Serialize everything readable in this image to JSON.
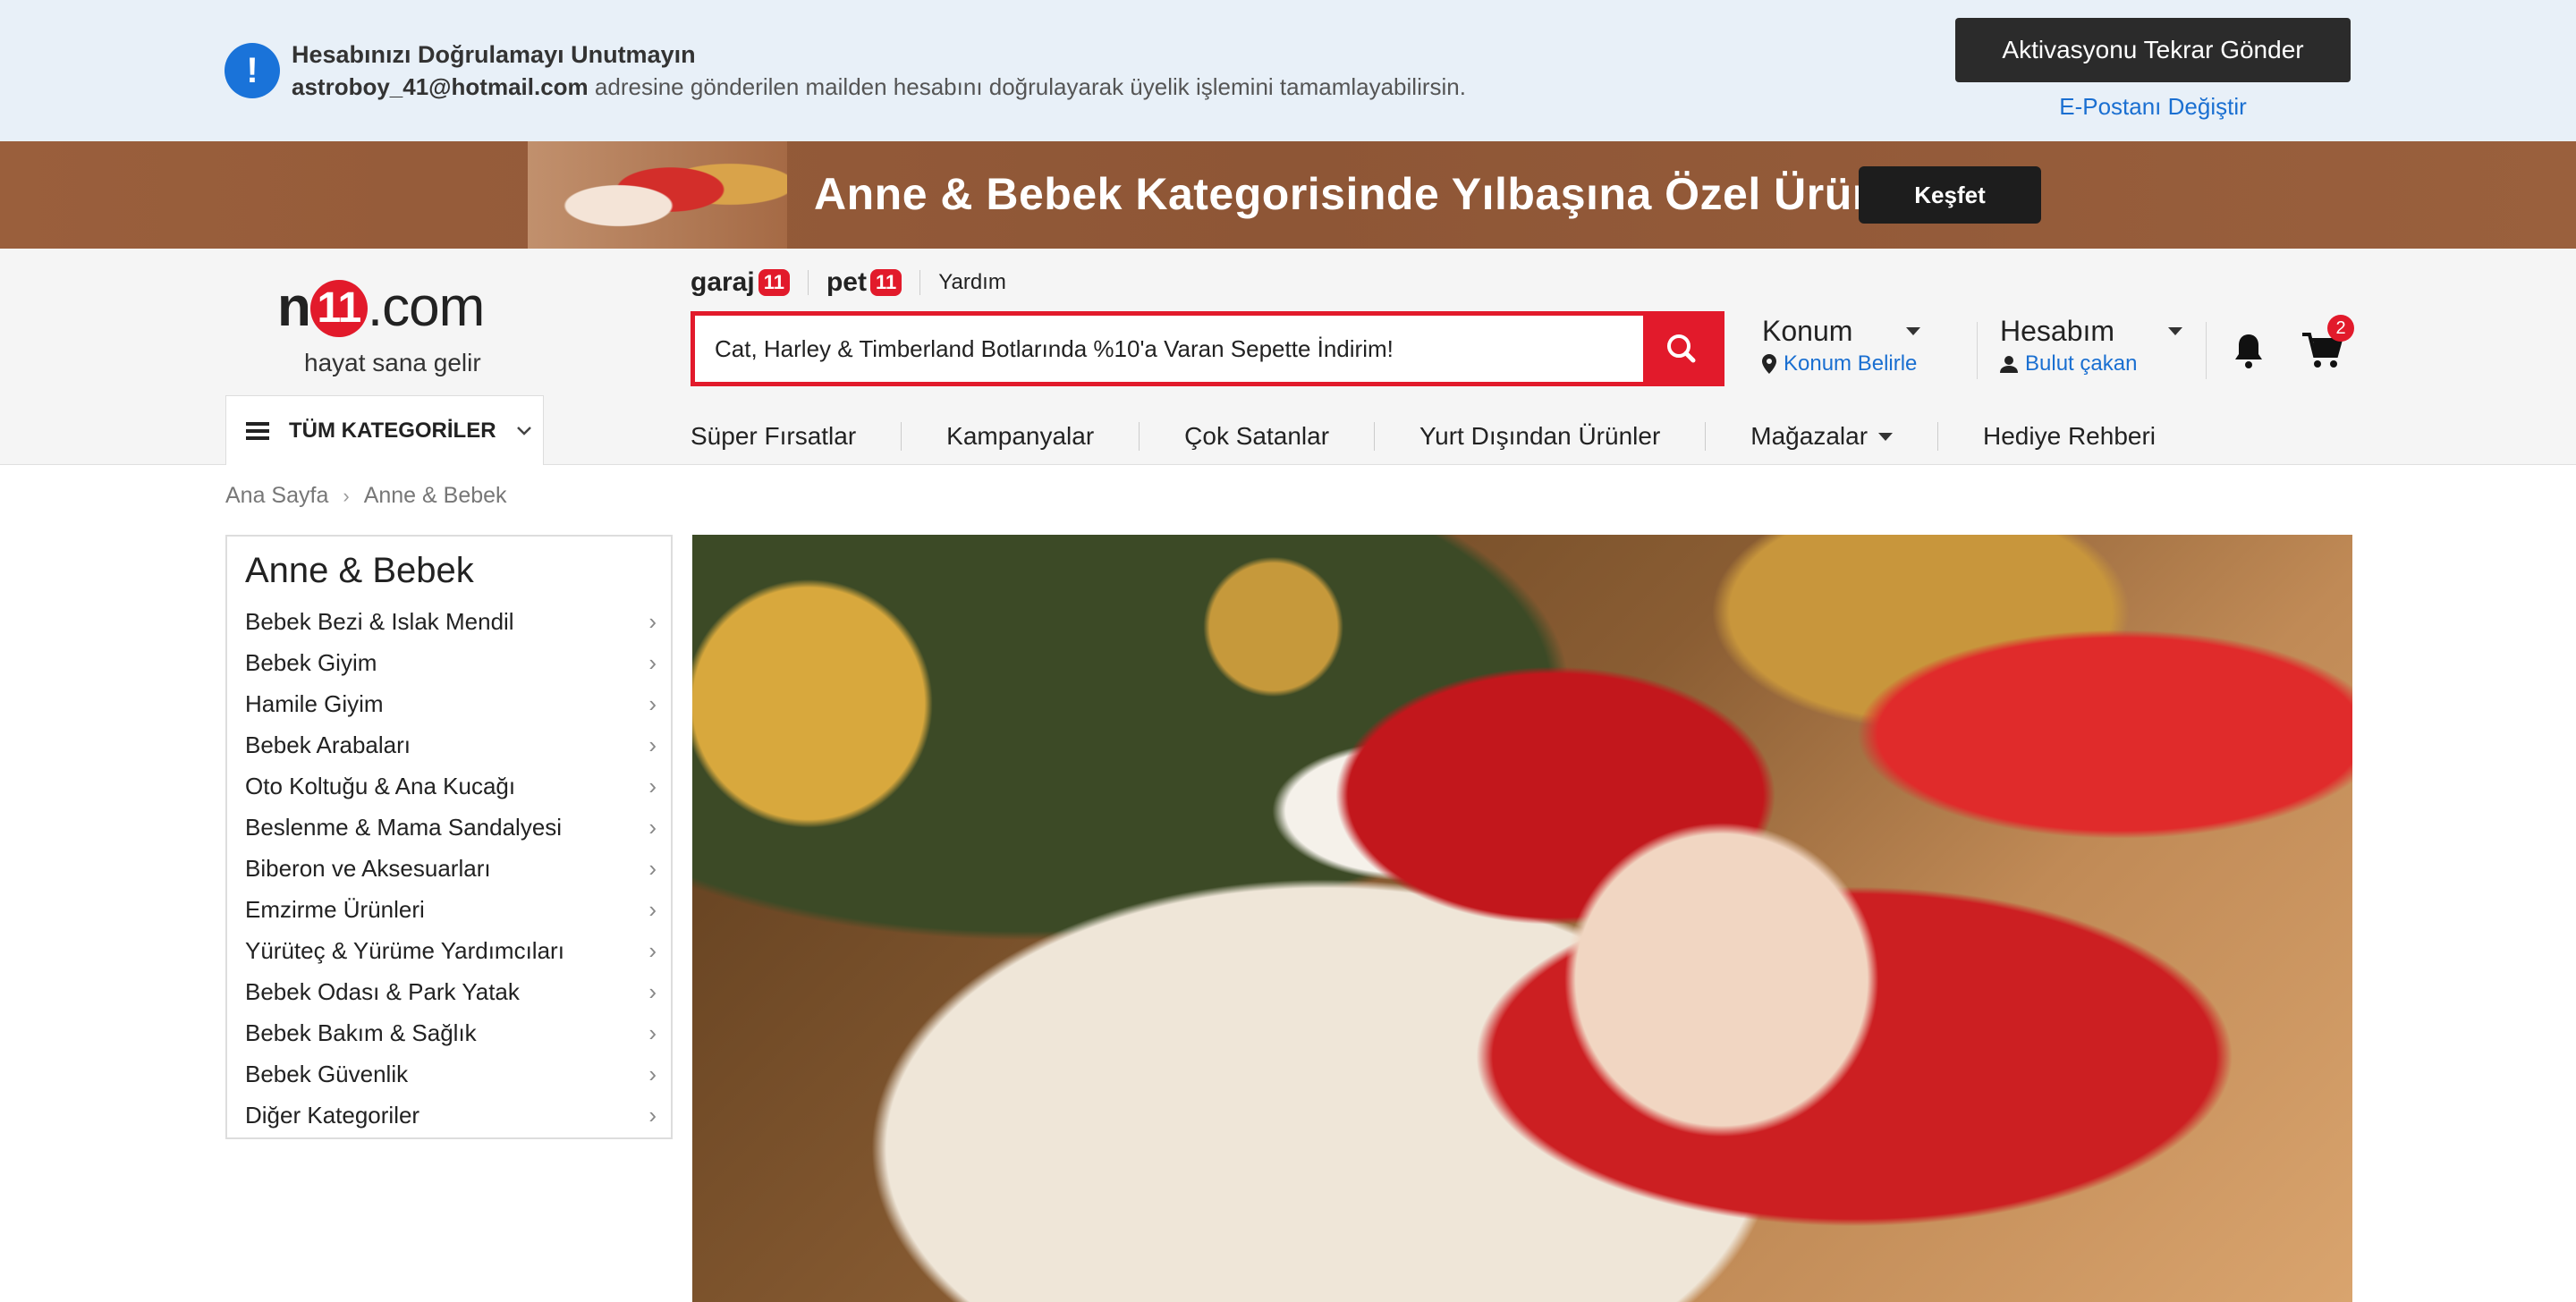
{
  "verify": {
    "icon": "exclamation-icon",
    "title": "Hesabınızı Doğrulamayı Unutmayın",
    "email": "astroboy_41@hotmail.com",
    "message": "adresine gönderilen mailden hesabını doğrulayarak üyelik işlemini tamamlayabilirsin.",
    "resend_label": "Aktivasyonu Tekrar Gönder",
    "change_email_label": "E-Postanı Değiştir"
  },
  "promo": {
    "text": "Anne & Bebek Kategorisinde Yılbaşına Özel Ürünler",
    "button": "Keşfet"
  },
  "header": {
    "logo": {
      "n": "n",
      "eleven": "11",
      "dotcom": ".com",
      "tagline": "hayat sana gelir"
    },
    "subnav": {
      "garaj": "garaj",
      "garaj_badge": "11",
      "pet": "pet",
      "pet_badge": "11",
      "help": "Yardım"
    },
    "search": {
      "value": "Cat, Harley & Timberland Botlarında %10'a Varan Sepette İndirim!"
    },
    "location": {
      "title": "Konum",
      "sub": "Konum Belirle"
    },
    "account": {
      "title": "Hesabım",
      "sub": "Bulut çakan"
    },
    "cart_count": "2",
    "all_categories": "TÜM KATEGORİLER",
    "nav": [
      "Süper Fırsatlar",
      "Kampanyalar",
      "Çok Satanlar",
      "Yurt Dışından Ürünler",
      "Mağazalar",
      "Hediye Rehberi"
    ]
  },
  "breadcrumb": [
    "Ana Sayfa",
    "Anne & Bebek"
  ],
  "sidebar": {
    "title": "Anne & Bebek",
    "items": [
      "Bebek Bezi & Islak Mendil",
      "Bebek Giyim",
      "Hamile Giyim",
      "Bebek Arabaları",
      "Oto Koltuğu & Ana Kucağı",
      "Beslenme & Mama Sandalyesi",
      "Biberon ve Aksesuarları",
      "Emzirme Ürünleri",
      "Yürüteç & Yürüme Yardımcıları",
      "Bebek Odası & Park Yatak",
      "Bebek Bakım & Sağlık",
      "Bebek Güvenlik",
      "Diğer Kategoriler"
    ]
  },
  "colors": {
    "brand_red": "#e21a2b",
    "link_blue": "#1a6fd1",
    "banner_bg": "#e8f0f8",
    "promo_brown": "#8e5636"
  }
}
